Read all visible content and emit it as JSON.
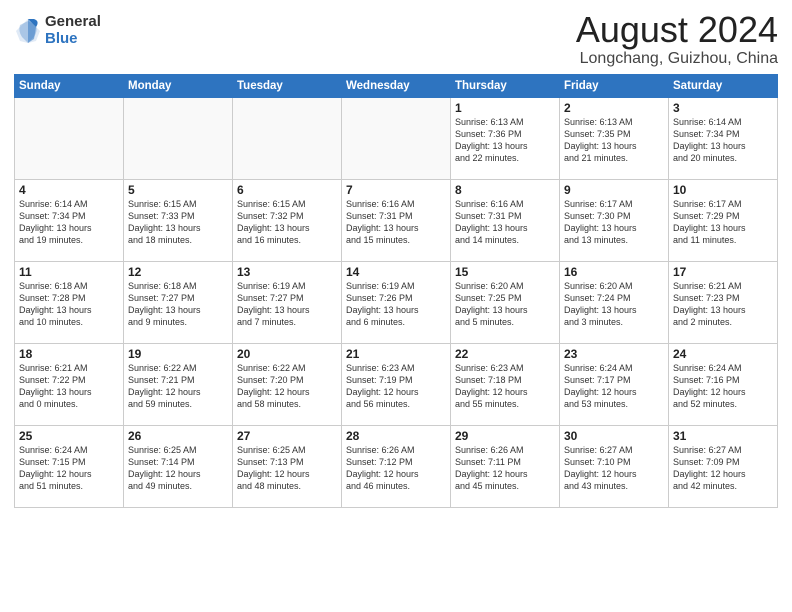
{
  "header": {
    "logo": {
      "general": "General",
      "blue": "Blue"
    },
    "title": "August 2024",
    "subtitle": "Longchang, Guizhou, China"
  },
  "weekdays": [
    "Sunday",
    "Monday",
    "Tuesday",
    "Wednesday",
    "Thursday",
    "Friday",
    "Saturday"
  ],
  "weeks": [
    [
      {
        "num": "",
        "info": ""
      },
      {
        "num": "",
        "info": ""
      },
      {
        "num": "",
        "info": ""
      },
      {
        "num": "",
        "info": ""
      },
      {
        "num": "1",
        "info": "Sunrise: 6:13 AM\nSunset: 7:36 PM\nDaylight: 13 hours\nand 22 minutes."
      },
      {
        "num": "2",
        "info": "Sunrise: 6:13 AM\nSunset: 7:35 PM\nDaylight: 13 hours\nand 21 minutes."
      },
      {
        "num": "3",
        "info": "Sunrise: 6:14 AM\nSunset: 7:34 PM\nDaylight: 13 hours\nand 20 minutes."
      }
    ],
    [
      {
        "num": "4",
        "info": "Sunrise: 6:14 AM\nSunset: 7:34 PM\nDaylight: 13 hours\nand 19 minutes."
      },
      {
        "num": "5",
        "info": "Sunrise: 6:15 AM\nSunset: 7:33 PM\nDaylight: 13 hours\nand 18 minutes."
      },
      {
        "num": "6",
        "info": "Sunrise: 6:15 AM\nSunset: 7:32 PM\nDaylight: 13 hours\nand 16 minutes."
      },
      {
        "num": "7",
        "info": "Sunrise: 6:16 AM\nSunset: 7:31 PM\nDaylight: 13 hours\nand 15 minutes."
      },
      {
        "num": "8",
        "info": "Sunrise: 6:16 AM\nSunset: 7:31 PM\nDaylight: 13 hours\nand 14 minutes."
      },
      {
        "num": "9",
        "info": "Sunrise: 6:17 AM\nSunset: 7:30 PM\nDaylight: 13 hours\nand 13 minutes."
      },
      {
        "num": "10",
        "info": "Sunrise: 6:17 AM\nSunset: 7:29 PM\nDaylight: 13 hours\nand 11 minutes."
      }
    ],
    [
      {
        "num": "11",
        "info": "Sunrise: 6:18 AM\nSunset: 7:28 PM\nDaylight: 13 hours\nand 10 minutes."
      },
      {
        "num": "12",
        "info": "Sunrise: 6:18 AM\nSunset: 7:27 PM\nDaylight: 13 hours\nand 9 minutes."
      },
      {
        "num": "13",
        "info": "Sunrise: 6:19 AM\nSunset: 7:27 PM\nDaylight: 13 hours\nand 7 minutes."
      },
      {
        "num": "14",
        "info": "Sunrise: 6:19 AM\nSunset: 7:26 PM\nDaylight: 13 hours\nand 6 minutes."
      },
      {
        "num": "15",
        "info": "Sunrise: 6:20 AM\nSunset: 7:25 PM\nDaylight: 13 hours\nand 5 minutes."
      },
      {
        "num": "16",
        "info": "Sunrise: 6:20 AM\nSunset: 7:24 PM\nDaylight: 13 hours\nand 3 minutes."
      },
      {
        "num": "17",
        "info": "Sunrise: 6:21 AM\nSunset: 7:23 PM\nDaylight: 13 hours\nand 2 minutes."
      }
    ],
    [
      {
        "num": "18",
        "info": "Sunrise: 6:21 AM\nSunset: 7:22 PM\nDaylight: 13 hours\nand 0 minutes."
      },
      {
        "num": "19",
        "info": "Sunrise: 6:22 AM\nSunset: 7:21 PM\nDaylight: 12 hours\nand 59 minutes."
      },
      {
        "num": "20",
        "info": "Sunrise: 6:22 AM\nSunset: 7:20 PM\nDaylight: 12 hours\nand 58 minutes."
      },
      {
        "num": "21",
        "info": "Sunrise: 6:23 AM\nSunset: 7:19 PM\nDaylight: 12 hours\nand 56 minutes."
      },
      {
        "num": "22",
        "info": "Sunrise: 6:23 AM\nSunset: 7:18 PM\nDaylight: 12 hours\nand 55 minutes."
      },
      {
        "num": "23",
        "info": "Sunrise: 6:24 AM\nSunset: 7:17 PM\nDaylight: 12 hours\nand 53 minutes."
      },
      {
        "num": "24",
        "info": "Sunrise: 6:24 AM\nSunset: 7:16 PM\nDaylight: 12 hours\nand 52 minutes."
      }
    ],
    [
      {
        "num": "25",
        "info": "Sunrise: 6:24 AM\nSunset: 7:15 PM\nDaylight: 12 hours\nand 51 minutes."
      },
      {
        "num": "26",
        "info": "Sunrise: 6:25 AM\nSunset: 7:14 PM\nDaylight: 12 hours\nand 49 minutes."
      },
      {
        "num": "27",
        "info": "Sunrise: 6:25 AM\nSunset: 7:13 PM\nDaylight: 12 hours\nand 48 minutes."
      },
      {
        "num": "28",
        "info": "Sunrise: 6:26 AM\nSunset: 7:12 PM\nDaylight: 12 hours\nand 46 minutes."
      },
      {
        "num": "29",
        "info": "Sunrise: 6:26 AM\nSunset: 7:11 PM\nDaylight: 12 hours\nand 45 minutes."
      },
      {
        "num": "30",
        "info": "Sunrise: 6:27 AM\nSunset: 7:10 PM\nDaylight: 12 hours\nand 43 minutes."
      },
      {
        "num": "31",
        "info": "Sunrise: 6:27 AM\nSunset: 7:09 PM\nDaylight: 12 hours\nand 42 minutes."
      }
    ]
  ]
}
